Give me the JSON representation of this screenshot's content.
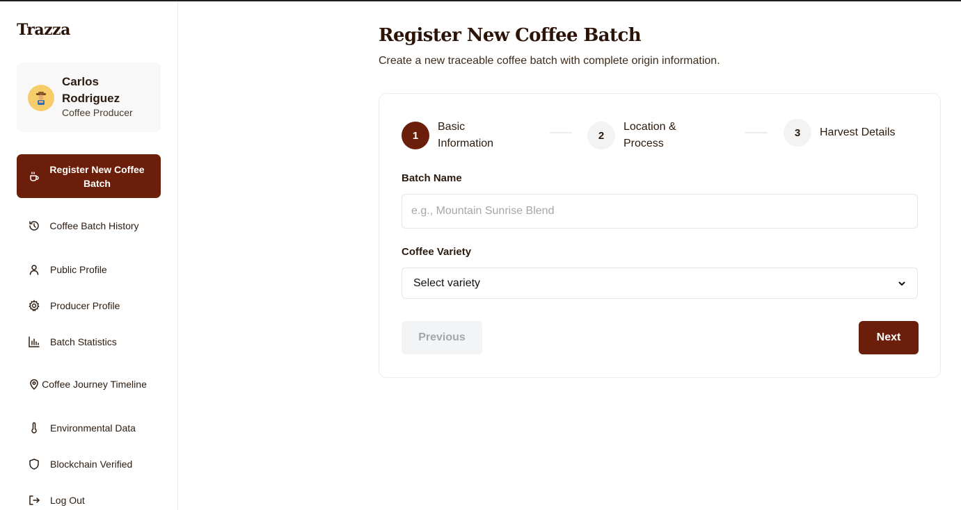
{
  "brand": "Trazza",
  "user": {
    "name": "Carlos Rodriguez",
    "role": "Coffee Producer"
  },
  "sidebar": {
    "items": [
      {
        "label": "Register New Coffee Batch",
        "icon": "coffee-cup-icon",
        "active": true
      },
      {
        "label": "Coffee Batch History",
        "icon": "history-icon"
      },
      {
        "label": "Public Profile",
        "icon": "user-icon"
      },
      {
        "label": "Producer Profile",
        "icon": "gear-icon"
      },
      {
        "label": "Batch Statistics",
        "icon": "bar-chart-icon"
      },
      {
        "label": "Coffee Journey Timeline",
        "icon": "map-pin-icon"
      },
      {
        "label": "Environmental Data",
        "icon": "thermometer-icon"
      },
      {
        "label": "Blockchain Verified",
        "icon": "shield-icon"
      },
      {
        "label": "Log Out",
        "icon": "logout-icon"
      }
    ]
  },
  "main": {
    "title": "Register New Coffee Batch",
    "subtitle": "Create a new traceable coffee batch with complete origin information.",
    "steps": [
      {
        "number": "1",
        "label": "Basic Information",
        "active": true
      },
      {
        "number": "2",
        "label": "Location & Process"
      },
      {
        "number": "3",
        "label": "Harvest Details"
      }
    ],
    "form": {
      "batch_name_label": "Batch Name",
      "batch_name_placeholder": "e.g., Mountain Sunrise Blend",
      "batch_name_value": "",
      "variety_label": "Coffee Variety",
      "variety_selected": "Select variety"
    },
    "buttons": {
      "previous": "Previous",
      "next": "Next"
    }
  },
  "colors": {
    "accent": "#6b1f0a",
    "avatar": "#f7cd6b",
    "text": "#2b1a0e"
  }
}
